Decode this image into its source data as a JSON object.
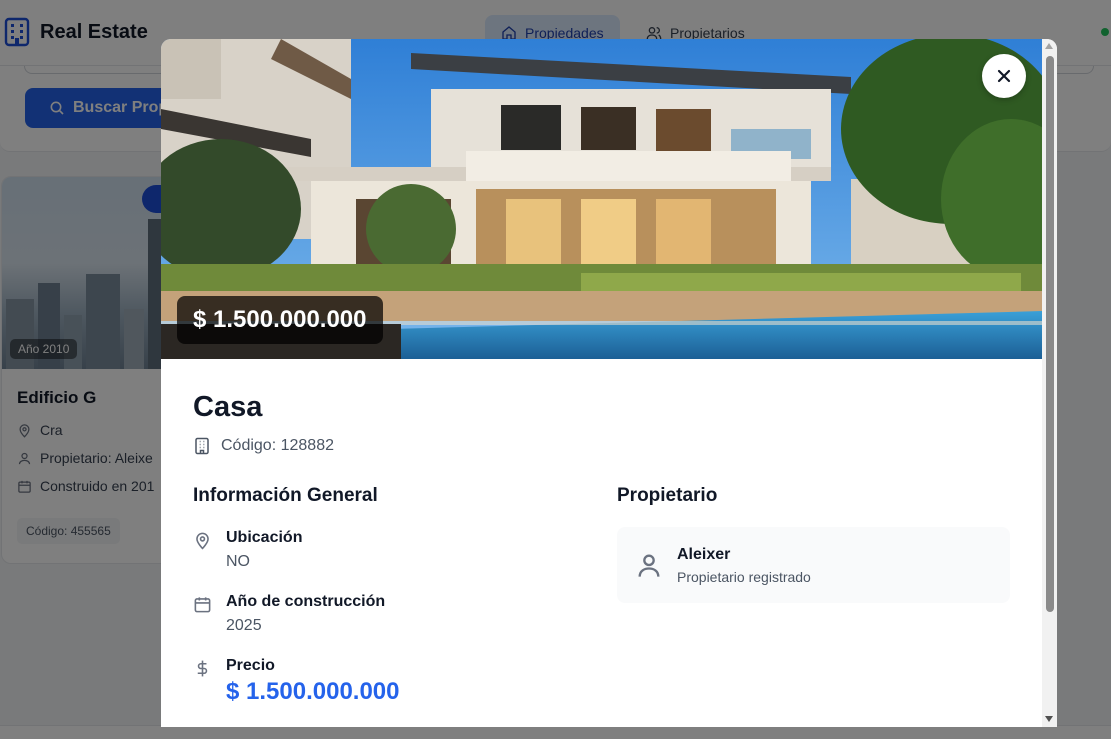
{
  "app": {
    "title": "Real Estate",
    "nav": [
      {
        "label": "Propiedades",
        "icon": "home-icon",
        "active": true
      },
      {
        "label": "Propietarios",
        "icon": "users-icon",
        "active": false
      }
    ]
  },
  "search": {
    "button_label": "Buscar Prop"
  },
  "background_card": {
    "year_badge": "Año 2010",
    "title": "Edificio G",
    "address": "Cra",
    "owner": "Propietario: Aleixe",
    "built": "Construido en 201",
    "code": "Código: 455565"
  },
  "modal": {
    "price_tag": "$ 1.500.000.000",
    "title": "Casa",
    "code": "Código: 128882",
    "general_section": {
      "heading": "Información General",
      "items": [
        {
          "label": "Ubicación",
          "value": "NO",
          "icon": "map-pin-icon"
        },
        {
          "label": "Año de construcción",
          "value": "2025",
          "icon": "calendar-icon"
        },
        {
          "label": "Precio",
          "value": "$ 1.500.000.000",
          "icon": "dollar-icon"
        }
      ]
    },
    "owner_section": {
      "heading": "Propietario",
      "name": "Aleixer",
      "subtitle": "Propietario registrado"
    }
  },
  "colors": {
    "accent": "#2563eb",
    "nav_active_bg": "#dbeafe",
    "status_online": "#22c55e",
    "overlay": "rgba(0,0,0,0.5)"
  }
}
